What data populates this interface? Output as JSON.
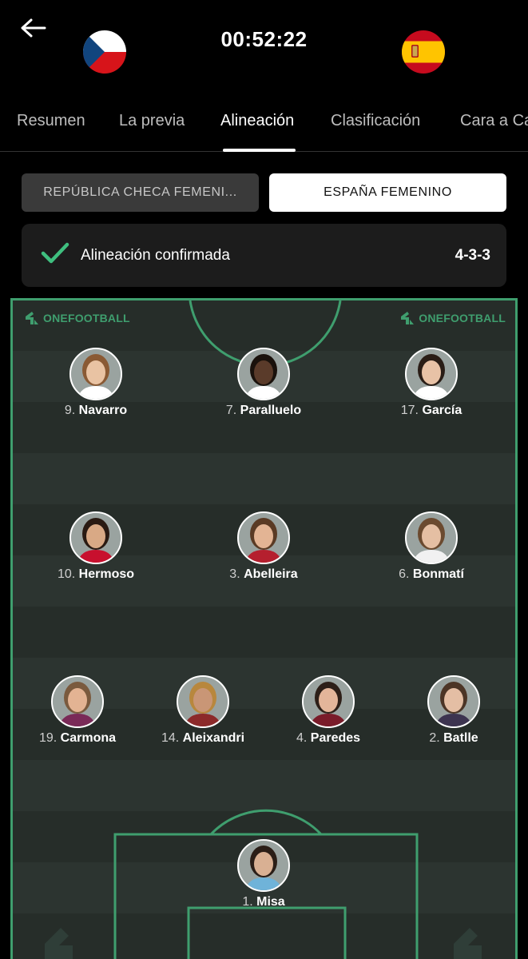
{
  "header": {
    "back_icon": "arrow-left-icon",
    "time": "00:52:22",
    "home_flag": "czech-flag-icon",
    "away_flag": "spain-flag-icon"
  },
  "tabs": [
    {
      "label": "Resumen",
      "active": false
    },
    {
      "label": "La previa",
      "active": false
    },
    {
      "label": "Alineación",
      "active": true
    },
    {
      "label": "Clasificación",
      "active": false
    },
    {
      "label": "Cara a Cara",
      "active": false
    }
  ],
  "team_toggle": {
    "home": "REPÚBLICA CHECA FEMENI...",
    "away": "ESPAÑA FEMENINO",
    "selected": "away"
  },
  "lineup": {
    "status": "Alineación confirmada",
    "formation": "4-3-3",
    "brand": "ONEFOOTBALL",
    "players": [
      {
        "number": "9.",
        "name": "Navarro",
        "skin": "#e9c3a3",
        "hair": "#8a5a34",
        "shirt": "#ffffff"
      },
      {
        "number": "7.",
        "name": "Paralluelo",
        "skin": "#5a3b2a",
        "hair": "#1a120c",
        "shirt": "#ffffff"
      },
      {
        "number": "17.",
        "name": "García",
        "skin": "#e8c2a6",
        "hair": "#2a1d16",
        "shirt": "#ffffff"
      },
      {
        "number": "10.",
        "name": "Hermoso",
        "skin": "#d9a985",
        "hair": "#2a1a12",
        "shirt": "#c8102e"
      },
      {
        "number": "3.",
        "name": "Abelleira",
        "skin": "#e3b494",
        "hair": "#5a3a24",
        "shirt": "#b51f2e"
      },
      {
        "number": "6.",
        "name": "Bonmatí",
        "skin": "#e5bfa3",
        "hair": "#6b4a2f",
        "shirt": "#f1f1f1"
      },
      {
        "number": "19.",
        "name": "Carmona",
        "skin": "#e3b393",
        "hair": "#7a5a3e",
        "shirt": "#7a2a58"
      },
      {
        "number": "14.",
        "name": "Aleixandri",
        "skin": "#c99676",
        "hair": "#b8873d",
        "shirt": "#8c2a2a"
      },
      {
        "number": "4.",
        "name": "Paredes",
        "skin": "#e3b59a",
        "hair": "#2d1f18",
        "shirt": "#7a1c2a"
      },
      {
        "number": "2.",
        "name": "Batlle",
        "skin": "#e4bea4",
        "hair": "#4c3526",
        "shirt": "#3d3450"
      },
      {
        "number": "1.",
        "name": "Misa",
        "skin": "#d9b093",
        "hair": "#2b1e17",
        "shirt": "#6fb3d9"
      }
    ]
  }
}
